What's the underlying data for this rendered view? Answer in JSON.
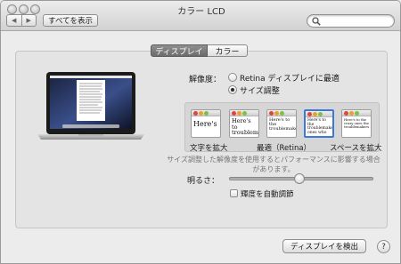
{
  "window": {
    "title": "カラー LCD"
  },
  "toolbar": {
    "back_glyph": "◀",
    "forward_glyph": "▶",
    "show_all_label": "すべてを表示",
    "search_placeholder": ""
  },
  "tabs": [
    {
      "label": "ディスプレイ",
      "selected": true
    },
    {
      "label": "カラー",
      "selected": false
    }
  ],
  "resolution": {
    "label": "解像度：",
    "options": [
      {
        "label": "Retina ディスプレイに最適",
        "selected": false
      },
      {
        "label": "サイズ調整",
        "selected": true
      }
    ],
    "scale_thumbnails": [
      {
        "text": "Here's",
        "selected": false
      },
      {
        "text": "Here's to troublem",
        "selected": false
      },
      {
        "text": "Here's to the troublemakers",
        "selected": false
      },
      {
        "text": "Here's to the troublemakers ones who",
        "selected": true
      },
      {
        "text": "Here's to the crazy ones the troublemakers",
        "selected": false
      }
    ],
    "captions": {
      "left": "文字を拡大",
      "middle": "最適（Retina）",
      "right": "スペースを拡大"
    },
    "note": "サイズ調整した解像度を使用するとパフォーマンスに影響する場合があります。"
  },
  "brightness": {
    "label": "明るさ：",
    "level": 0.49,
    "auto_label": "輝度を自動調節",
    "auto_checked": false
  },
  "footer": {
    "detect_label": "ディスプレイを検出",
    "help_label": "?"
  }
}
